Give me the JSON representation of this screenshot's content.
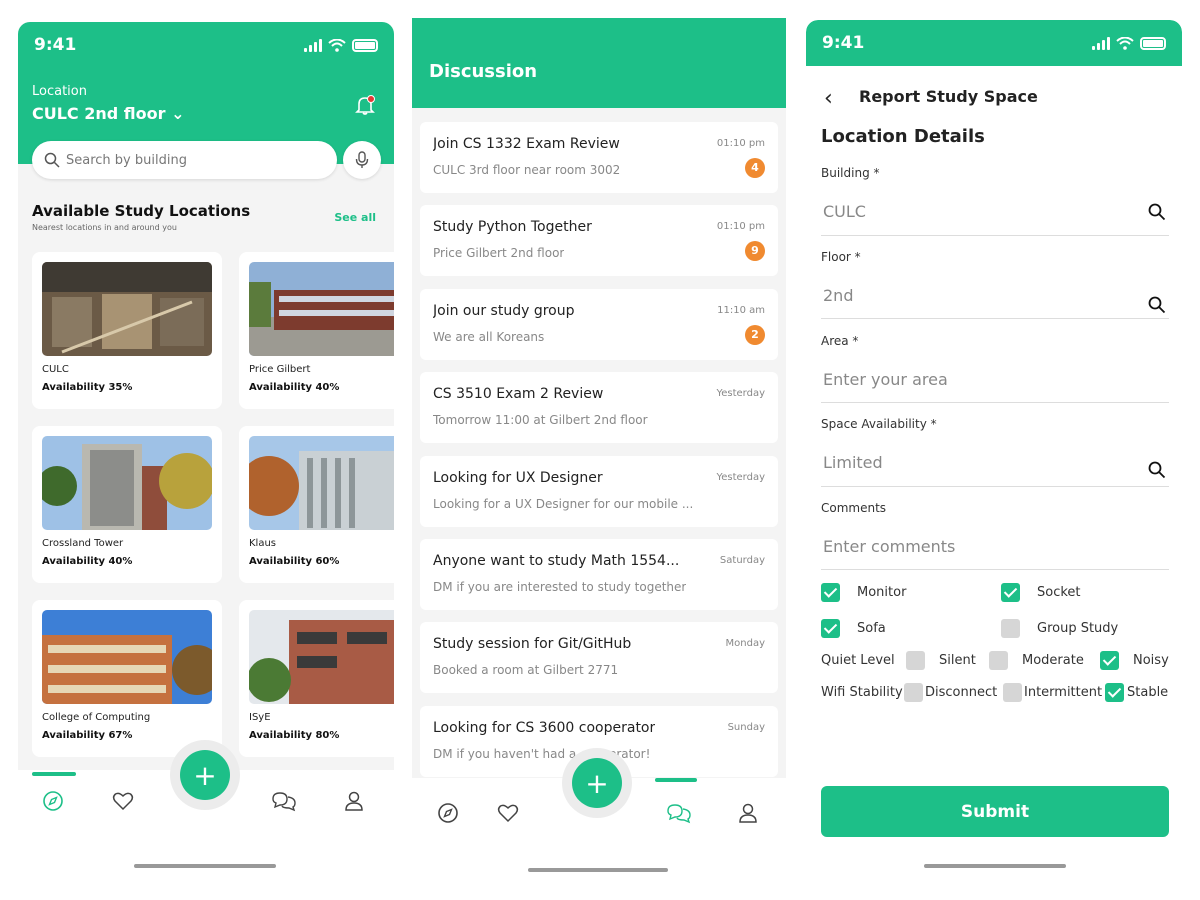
{
  "home": {
    "time": "9:41",
    "location_label": "Location",
    "location_value": "CULC 2nd floor",
    "search_placeholder": "Search by building",
    "section_title": "Available Study Locations",
    "section_subtitle": "Nearest locations in and around you",
    "see_all": "See all",
    "cards": [
      {
        "name": "CULC",
        "availability": "Availability 35%",
        "photo_color": "#6b5a46"
      },
      {
        "name": "Price Gilbert",
        "availability": "Availability 40%",
        "photo_color": "#6a7fa0"
      },
      {
        "name": "Crossland Tower",
        "availability": "Availability 40%",
        "photo_color": "#8f8c84"
      },
      {
        "name": "Klaus",
        "availability": "Availability 60%",
        "photo_color": "#9aa7a8"
      },
      {
        "name": "College of Computing",
        "availability": "Availability 67%",
        "photo_color": "#b6683f"
      },
      {
        "name": "ISyE",
        "availability": "Availability 80%",
        "photo_color": "#a65a44"
      }
    ],
    "fab_label": "+"
  },
  "discussion": {
    "title": "Discussion",
    "messages": [
      {
        "title": "Join CS 1332 Exam Review",
        "subtitle": "CULC 3rd floor near room 3002",
        "time": "01:10 pm",
        "badge": "4"
      },
      {
        "title": "Study Python Together",
        "subtitle": "Price Gilbert 2nd floor",
        "time": "01:10 pm",
        "badge": "9"
      },
      {
        "title": "Join our study group",
        "subtitle": "We are all Koreans",
        "time": "11:10 am",
        "badge": "2"
      },
      {
        "title": "CS 3510 Exam 2 Review",
        "subtitle": "Tomorrow 11:00 at Gilbert 2nd floor",
        "time": "Yesterday",
        "badge": ""
      },
      {
        "title": "Looking for UX Designer",
        "subtitle": "Looking for a UX Designer for our mobile ...",
        "time": "Yesterday",
        "badge": ""
      },
      {
        "title": "Anyone want to study Math 1554...",
        "subtitle": "DM if you are interested to study together",
        "time": "Saturday",
        "badge": ""
      },
      {
        "title": "Study session for Git/GitHub",
        "subtitle": "Booked a room at Gilbert 2771",
        "time": "Monday",
        "badge": ""
      },
      {
        "title": "Looking for CS 3600 cooperator",
        "subtitle": "DM if you haven't had a cooperator!",
        "time": "Sunday",
        "badge": ""
      }
    ],
    "fab_label": "+"
  },
  "report": {
    "time": "9:41",
    "title": "Report Study Space",
    "section": "Location Details",
    "building_label": "Building *",
    "building_value": "CULC",
    "floor_label": "Floor *",
    "floor_value": "2nd",
    "area_label": "Area *",
    "area_placeholder": "Enter your area",
    "availability_label": "Space Availability *",
    "availability_value": "Limited",
    "comments_label": "Comments",
    "comments_placeholder": "Enter comments",
    "monitor": "Monitor",
    "socket": "Socket",
    "sofa": "Sofa",
    "group_study": "Group Study",
    "quiet_label": "Quiet Level",
    "silent": "Silent",
    "moderate": "Moderate",
    "noisy": "Noisy",
    "wifi_label": "Wifi Stability",
    "disconnect": "Disconnect",
    "intermittent": "Intermittent",
    "stable": "Stable",
    "submit": "Submit"
  },
  "colors": {
    "brand": "#1dbf88",
    "badge": "#f08a30"
  }
}
